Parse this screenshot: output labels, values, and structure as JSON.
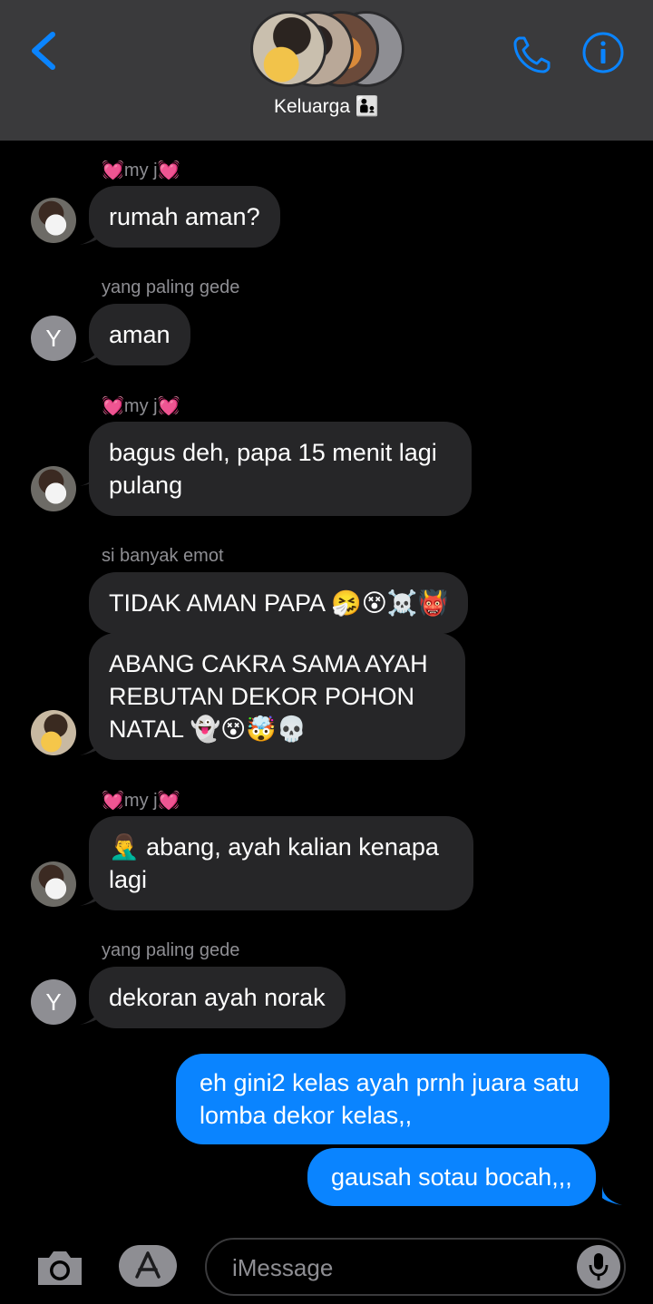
{
  "header": {
    "title": "Keluarga",
    "title_emoji": "👨‍👦",
    "back_icon": "chevron-left-icon",
    "call_icon": "phone-icon",
    "info_icon": "info-icon",
    "accent_color": "#0a84ff"
  },
  "messages": [
    {
      "sender": "my j",
      "sender_decor": "💓",
      "text": "rumah aman?",
      "avatar": "photo"
    },
    {
      "sender": "yang paling gede",
      "text": "aman",
      "avatar_letter": "Y"
    },
    {
      "sender": "my j",
      "sender_decor": "💓",
      "text_line1": "bagus deh, papa 15 menit lagi",
      "text_line2": "pulang",
      "avatar": "photo"
    },
    {
      "sender": "si banyak emot",
      "text": "TIDAK AMAN PAPA 🤧😵☠️👹"
    },
    {
      "text_line1": "ABANG CAKRA SAMA AYAH",
      "text_line2": "REBUTAN DEKOR POHON",
      "text_line3": "NATAL 👻😵🤯💀",
      "avatar": "photo2"
    },
    {
      "sender": "my j",
      "sender_decor": "💓",
      "text_line1": "🤦‍♂️ abang, ayah kalian kenapa",
      "text_line2": "lagi",
      "avatar": "photo"
    },
    {
      "sender": "yang paling gede",
      "text": "dekoran ayah norak",
      "avatar_letter": "Y"
    },
    {
      "outgoing": true,
      "text_line1": "eh gini2 kelas ayah prnh juara satu",
      "text_line2": "lomba dekor kelas,,"
    },
    {
      "outgoing": true,
      "text": "gausah sotau bocah,,,"
    }
  ],
  "composer": {
    "placeholder": "iMessage",
    "camera_icon": "camera-icon",
    "apps_icon": "app-store-icon",
    "mic_icon": "microphone-icon"
  }
}
